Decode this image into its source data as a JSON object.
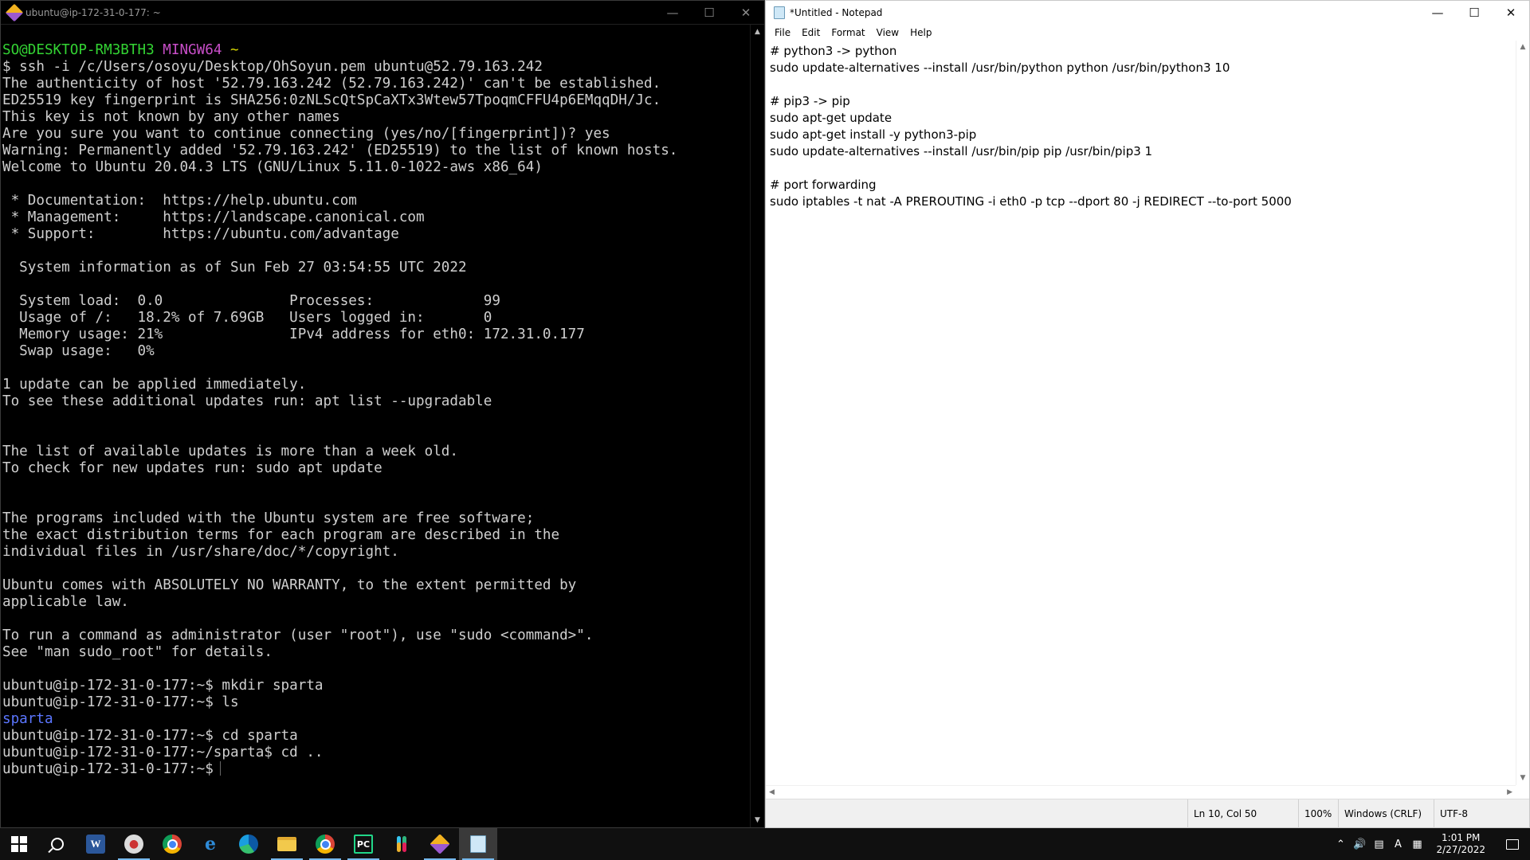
{
  "terminal": {
    "title": "ubuntu@ip-172-31-0-177: ~",
    "prompt_user_host": "SO@DESKTOP-RM3BTH3",
    "prompt_env": "MINGW64",
    "prompt_dir": "~",
    "lines": [
      "$ ssh -i /c/Users/osoyu/Desktop/OhSoyun.pem ubuntu@52.79.163.242",
      "The authenticity of host '52.79.163.242 (52.79.163.242)' can't be established.",
      "ED25519 key fingerprint is SHA256:0zNLScQtSpCaXTx3Wtew57TpoqmCFFU4p6EMqqDH/Jc.",
      "This key is not known by any other names",
      "Are you sure you want to continue connecting (yes/no/[fingerprint])? yes",
      "Warning: Permanently added '52.79.163.242' (ED25519) to the list of known hosts.",
      "Welcome to Ubuntu 20.04.3 LTS (GNU/Linux 5.11.0-1022-aws x86_64)",
      "",
      " * Documentation:  https://help.ubuntu.com",
      " * Management:     https://landscape.canonical.com",
      " * Support:        https://ubuntu.com/advantage",
      "",
      "  System information as of Sun Feb 27 03:54:55 UTC 2022",
      "",
      "  System load:  0.0               Processes:             99",
      "  Usage of /:   18.2% of 7.69GB   Users logged in:       0",
      "  Memory usage: 21%               IPv4 address for eth0: 172.31.0.177",
      "  Swap usage:   0%",
      "",
      "1 update can be applied immediately.",
      "To see these additional updates run: apt list --upgradable",
      "",
      "",
      "The list of available updates is more than a week old.",
      "To check for new updates run: sudo apt update",
      "",
      "",
      "The programs included with the Ubuntu system are free software;",
      "the exact distribution terms for each program are described in the",
      "individual files in /usr/share/doc/*/copyright.",
      "",
      "Ubuntu comes with ABSOLUTELY NO WARRANTY, to the extent permitted by",
      "applicable law.",
      "",
      "To run a command as administrator (user \"root\"), use \"sudo <command>\".",
      "See \"man sudo_root\" for details.",
      "",
      "ubuntu@ip-172-31-0-177:~$ mkdir sparta",
      "ubuntu@ip-172-31-0-177:~$ ls"
    ],
    "ls_output": "sparta",
    "after_lines": [
      "ubuntu@ip-172-31-0-177:~$ cd sparta",
      "ubuntu@ip-172-31-0-177:~/sparta$ cd .."
    ],
    "current_prompt": "ubuntu@ip-172-31-0-177:~$"
  },
  "notepad": {
    "title": "*Untitled - Notepad",
    "menu": [
      "File",
      "Edit",
      "Format",
      "View",
      "Help"
    ],
    "content": "# python3 -> python\nsudo update-alternatives --install /usr/bin/python python /usr/bin/python3 10\n\n# pip3 -> pip\nsudo apt-get update\nsudo apt-get install -y python3-pip\nsudo update-alternatives --install /usr/bin/pip pip /usr/bin/pip3 1\n\n# port forwarding\nsudo iptables -t nat -A PREROUTING -i eth0 -p tcp --dport 80 -j REDIRECT --to-port 5000",
    "status": {
      "position": "Ln 10, Col 50",
      "zoom": "100%",
      "line_ending": "Windows (CRLF)",
      "encoding": "UTF-8"
    }
  },
  "taskbar": {
    "apps": [
      "start-icon",
      "search-icon",
      "word-icon",
      "paint-icon",
      "chrome-icon",
      "internet-explorer-icon",
      "edge-icon",
      "file-explorer-icon",
      "chrome-profile-icon",
      "pycharm-icon",
      "slack-icon",
      "git-bash-icon",
      "notepad-icon"
    ],
    "tray_lang": "A",
    "time": "1:01 PM",
    "date": "2/27/2022"
  }
}
